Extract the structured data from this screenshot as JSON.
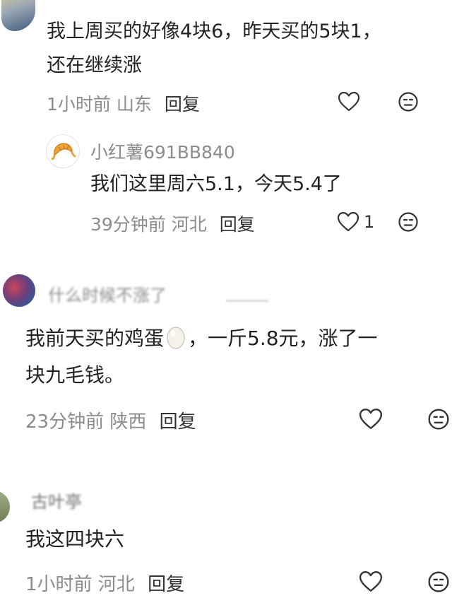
{
  "comments": [
    {
      "text_line1": "我上周买的好像4块6，昨天买的5块1，",
      "text_line2": "还在继续涨",
      "time": "1小时前",
      "location": "山东",
      "reply_label": "回复"
    },
    {
      "username": "小红薯691BB840",
      "text": "我们这里周六5.1，今天5.4了",
      "time": "39分钟前",
      "location": "河北",
      "reply_label": "回复",
      "like_count": "1"
    },
    {
      "username": "什么时候不涨了",
      "text_line1": "我前天买的鸡蛋",
      "text_line1_after": "，一斤5.8元，涨了一",
      "text_line2": "块九毛钱。",
      "time": "23分钟前",
      "location": "陕西",
      "reply_label": "回复"
    },
    {
      "username": "古叶亭",
      "text": "我这四块六",
      "time": "1小时前",
      "location": "河北",
      "reply_label": "回复"
    }
  ],
  "icons": {
    "like": "heart-outline-icon",
    "dislike": "meh-face-icon",
    "egg": "egg-emoji-icon",
    "croissant": "croissant-avatar-icon"
  }
}
